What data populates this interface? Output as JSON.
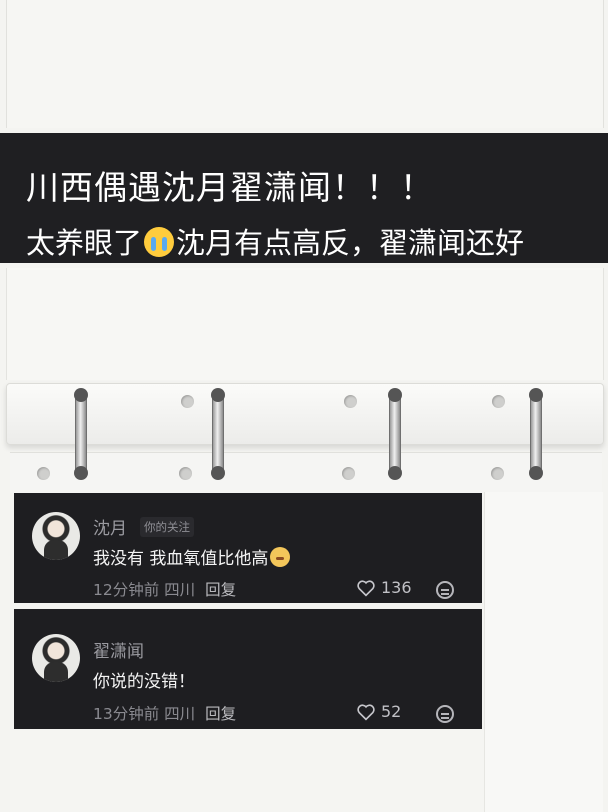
{
  "banner": {
    "title": "川西偶遇沈月翟潇闻！！！",
    "subtitle_before_emoji": "太养眼了",
    "subtitle_after_emoji": "沈月有点高反，翟潇闻还好"
  },
  "comments": [
    {
      "username": "沈月",
      "follow_tag": "你的关注",
      "text": "我没有 我血氧值比他高",
      "meta": "12分钟前 四川",
      "reply_label": "回复",
      "likes": "136"
    },
    {
      "username": "翟潇闻",
      "text": "你说的没错！",
      "meta": "13分钟前 四川",
      "reply_label": "回复",
      "likes": "52"
    }
  ],
  "icons": {
    "banner_emoji": "crying-face-icon",
    "comment_emoji": "smiling-emoji-icon",
    "like": "heart-icon",
    "emoji_reply": "emoji-face-icon"
  },
  "colors": {
    "banner_bg": "#1f1f22",
    "card_bg": "#1e1e21",
    "paper": "#f4f4f1"
  }
}
